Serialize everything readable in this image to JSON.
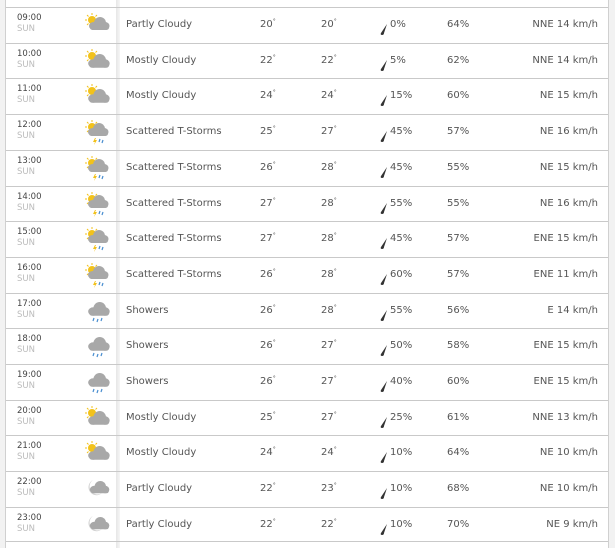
{
  "colors": {
    "sun": "#f2c21b",
    "cloud": "#a8a8a8",
    "rain": "#4a8fd0",
    "bolt": "#f2c21b",
    "text": "#555555"
  },
  "rows": [
    {
      "time": "09:00",
      "day": "SUN",
      "icon": "partly-cloudy-day",
      "condition": "Partly Cloudy",
      "temp": "20",
      "feels": "20",
      "precip": "0%",
      "humidity": "64%",
      "wind": "NNE 14 km/h"
    },
    {
      "time": "10:00",
      "day": "SUN",
      "icon": "mostly-cloudy-day",
      "condition": "Mostly Cloudy",
      "temp": "22",
      "feels": "22",
      "precip": "5%",
      "humidity": "62%",
      "wind": "NNE 14 km/h"
    },
    {
      "time": "11:00",
      "day": "SUN",
      "icon": "mostly-cloudy-day",
      "condition": "Mostly Cloudy",
      "temp": "24",
      "feels": "24",
      "precip": "15%",
      "humidity": "60%",
      "wind": "NE 15 km/h"
    },
    {
      "time": "12:00",
      "day": "SUN",
      "icon": "scattered-tstorms",
      "condition": "Scattered T-Storms",
      "temp": "25",
      "feels": "27",
      "precip": "45%",
      "humidity": "57%",
      "wind": "NE 16 km/h"
    },
    {
      "time": "13:00",
      "day": "SUN",
      "icon": "scattered-tstorms",
      "condition": "Scattered T-Storms",
      "temp": "26",
      "feels": "28",
      "precip": "45%",
      "humidity": "55%",
      "wind": "NE 15 km/h"
    },
    {
      "time": "14:00",
      "day": "SUN",
      "icon": "scattered-tstorms",
      "condition": "Scattered T-Storms",
      "temp": "27",
      "feels": "28",
      "precip": "55%",
      "humidity": "55%",
      "wind": "NE 16 km/h"
    },
    {
      "time": "15:00",
      "day": "SUN",
      "icon": "scattered-tstorms",
      "condition": "Scattered T-Storms",
      "temp": "27",
      "feels": "28",
      "precip": "45%",
      "humidity": "57%",
      "wind": "ENE 15 km/h"
    },
    {
      "time": "16:00",
      "day": "SUN",
      "icon": "scattered-tstorms",
      "condition": "Scattered T-Storms",
      "temp": "26",
      "feels": "28",
      "precip": "60%",
      "humidity": "57%",
      "wind": "ENE 11 km/h"
    },
    {
      "time": "17:00",
      "day": "SUN",
      "icon": "showers",
      "condition": "Showers",
      "temp": "26",
      "feels": "28",
      "precip": "55%",
      "humidity": "56%",
      "wind": "E 14 km/h"
    },
    {
      "time": "18:00",
      "day": "SUN",
      "icon": "showers",
      "condition": "Showers",
      "temp": "26",
      "feels": "27",
      "precip": "50%",
      "humidity": "58%",
      "wind": "ENE 15 km/h"
    },
    {
      "time": "19:00",
      "day": "SUN",
      "icon": "showers",
      "condition": "Showers",
      "temp": "26",
      "feels": "27",
      "precip": "40%",
      "humidity": "60%",
      "wind": "ENE 15 km/h"
    },
    {
      "time": "20:00",
      "day": "SUN",
      "icon": "mostly-cloudy-day",
      "condition": "Mostly Cloudy",
      "temp": "25",
      "feels": "27",
      "precip": "25%",
      "humidity": "61%",
      "wind": "NNE 13 km/h"
    },
    {
      "time": "21:00",
      "day": "SUN",
      "icon": "mostly-cloudy-day",
      "condition": "Mostly Cloudy",
      "temp": "24",
      "feels": "24",
      "precip": "10%",
      "humidity": "64%",
      "wind": "NE 10 km/h"
    },
    {
      "time": "22:00",
      "day": "SUN",
      "icon": "partly-cloudy-night",
      "condition": "Partly Cloudy",
      "temp": "22",
      "feels": "23",
      "precip": "10%",
      "humidity": "68%",
      "wind": "NE 10 km/h"
    },
    {
      "time": "23:00",
      "day": "SUN",
      "icon": "partly-cloudy-night",
      "condition": "Partly Cloudy",
      "temp": "22",
      "feels": "22",
      "precip": "10%",
      "humidity": "70%",
      "wind": "NE 9 km/h"
    }
  ]
}
